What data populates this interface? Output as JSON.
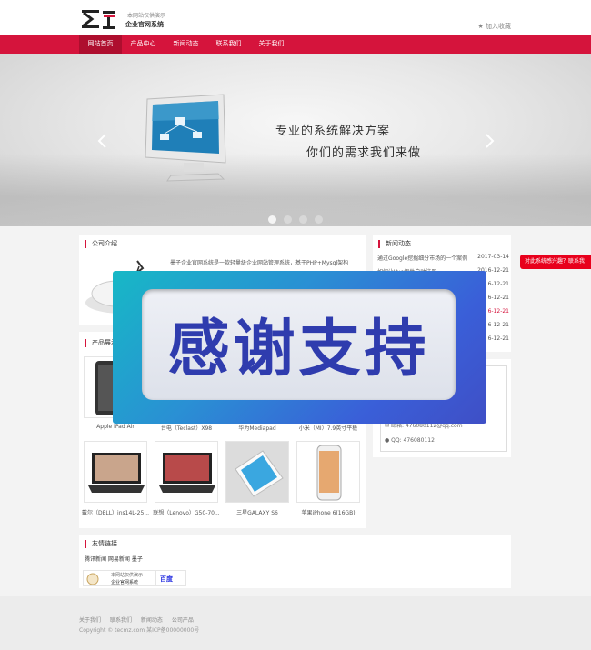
{
  "header": {
    "logo_sub": "本网站仅供演示",
    "logo_name": "企业官网系统",
    "favorite": "★ 加入收藏"
  },
  "nav": {
    "items": [
      {
        "label": "网站首页",
        "active": true
      },
      {
        "label": "产品中心"
      },
      {
        "label": "新闻动态"
      },
      {
        "label": "联系我们"
      },
      {
        "label": "关于我们"
      }
    ]
  },
  "banner": {
    "line1": "专业的系统解决方案",
    "line2": "你们的需求我们来做",
    "slide_count": 4,
    "active_slide": 1
  },
  "about": {
    "title": "公司介绍",
    "text": "墨子企业官网系统是一款轻量级企业网站管理系统，基于PHP+Mysql架构"
  },
  "news": {
    "title": "新闻动态",
    "items": [
      {
        "title": "通过Google挖掘细分市场的一个案例",
        "date": "2017-03-14"
      },
      {
        "title": "如何让Vue组件自动注册",
        "date": "2016-12-21"
      },
      {
        "title": "",
        "date": "6-12-21"
      },
      {
        "title": "",
        "date": "6-12-21"
      },
      {
        "title": "",
        "date": "6-12-21"
      },
      {
        "title": "",
        "date": "6-12-21"
      },
      {
        "title": "",
        "date": "6-12-21"
      }
    ]
  },
  "products": {
    "title": "产品展示",
    "items": [
      {
        "name": "Apple iPad Air"
      },
      {
        "name": "台电（Teclast）X98"
      },
      {
        "name": "华为Mediapad"
      },
      {
        "name": "小米（MI）7.9英寸平板"
      },
      {
        "name": "戴尔（DELL）ins14L-25..."
      },
      {
        "name": "联想（Lenovo）G50-70..."
      },
      {
        "name": "三星GALAXY S6"
      },
      {
        "name": "苹果iPhone 6(16GB)"
      }
    ]
  },
  "contact": {
    "email": "邮箱: 476080112@qq.com",
    "qq": "QQ: 476080112"
  },
  "float_button": "对此系统感兴趣？联系我",
  "links": {
    "title": "友情链接",
    "text": "腾讯新闻 网易新闻 墨子",
    "logo1_sub": "本网站仅供演示",
    "logo1_name": "企业官网系统",
    "logo2": "百度"
  },
  "footer": {
    "links": [
      "关于我们",
      "联系我们",
      "新闻动态",
      "公司产品"
    ],
    "copyright": "Copyright © tecmz.com 某ICP备00000000号"
  },
  "overlay": {
    "text": "感谢支持"
  },
  "colors": {
    "brand": "#d5143c",
    "overlay_text": "#2f3cae"
  }
}
